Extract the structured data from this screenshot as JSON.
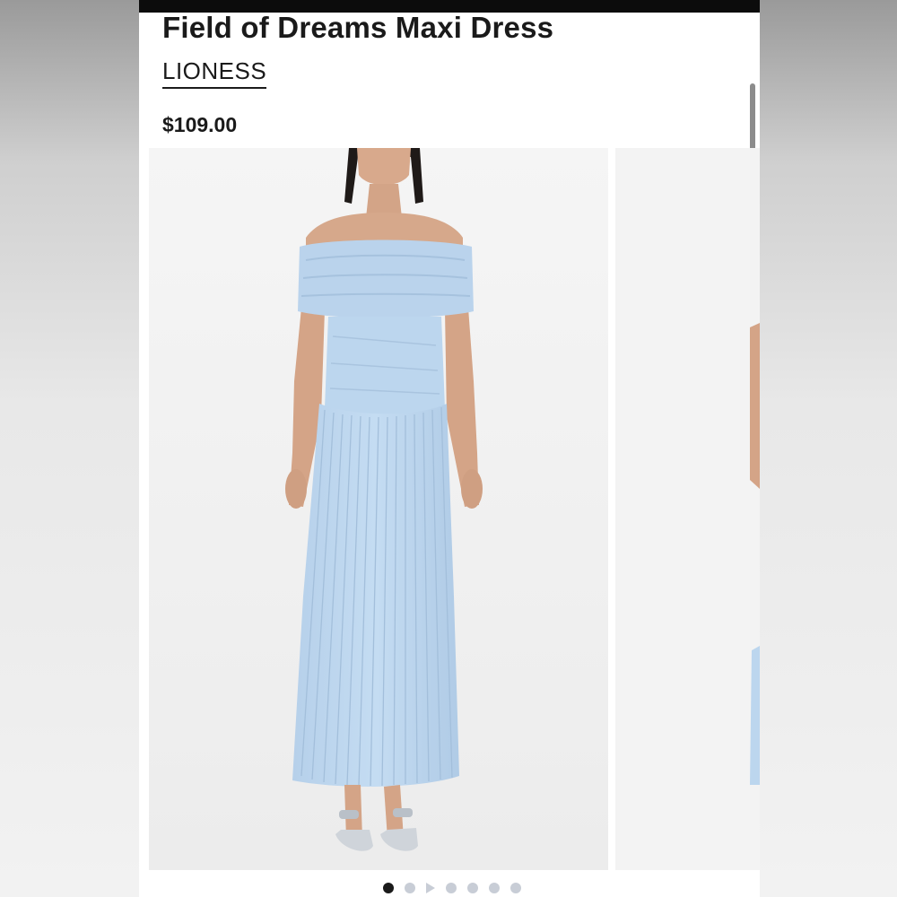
{
  "product": {
    "title": "Field of Dreams Maxi Dress",
    "brand": "LIONESS",
    "price": "$109.00"
  },
  "gallery": {
    "slide_count": 7,
    "active_index": 0,
    "video_slide_index": 2
  },
  "colors": {
    "dress": "#bcd6ee",
    "text": "#1a1a1a",
    "dot_active": "#1a1a1a",
    "dot_inactive": "#c8cdd6"
  }
}
